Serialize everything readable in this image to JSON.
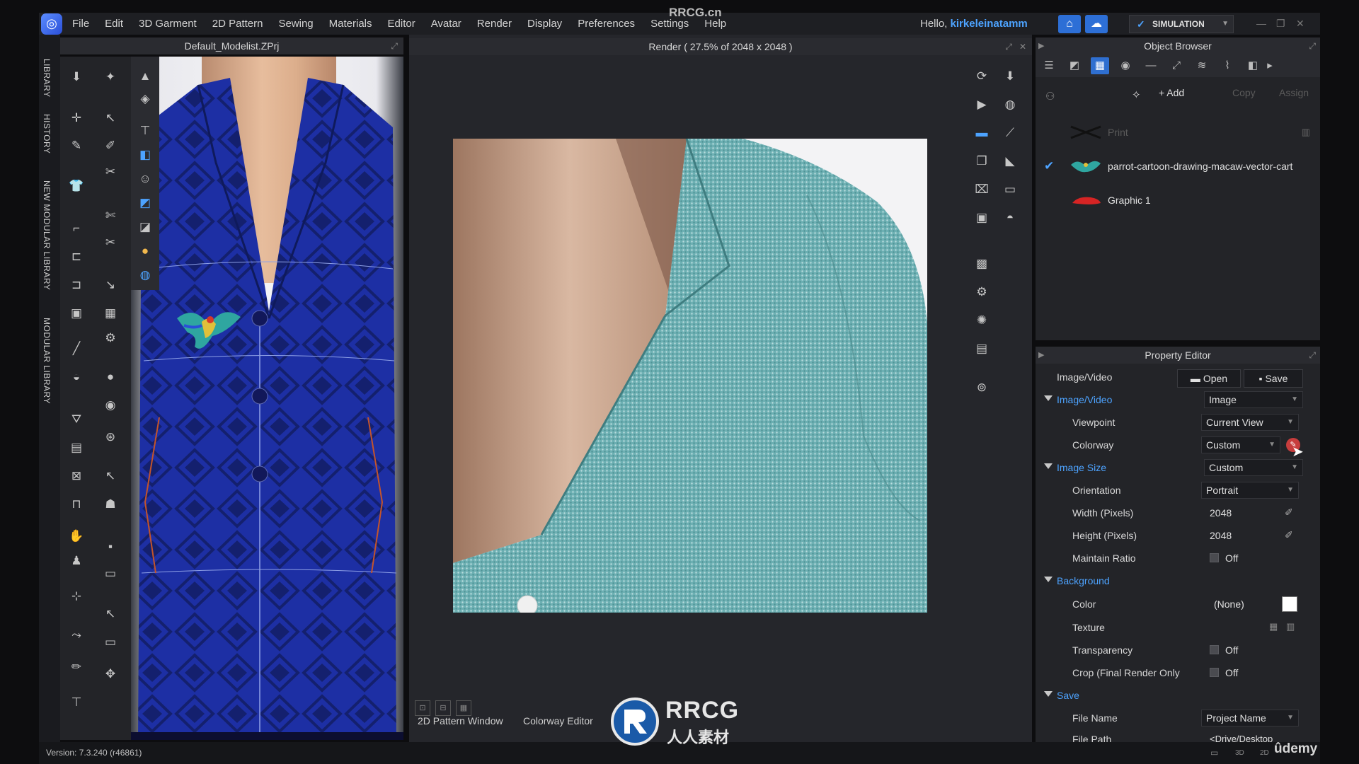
{
  "watermark_top": "RRCG.cn",
  "menubar": {
    "items": [
      "File",
      "Edit",
      "3D Garment",
      "2D Pattern",
      "Sewing",
      "Materials",
      "Editor",
      "Avatar",
      "Render",
      "Display",
      "Preferences",
      "Settings",
      "Help"
    ],
    "greeting": "Hello,",
    "username": "kirkeleinatamm",
    "mode": "SIMULATION"
  },
  "left_tabs": [
    "LIBRARY",
    "HISTORY",
    "NEW MODULAR LIBRARY",
    "MODULAR LIBRARY"
  ],
  "window3d": {
    "title": "Default_Modelist.ZPrj"
  },
  "render": {
    "title": "Render ( 27.5% of 2048 x 2048 )",
    "bottom_tabs": [
      "2D Pattern Window",
      "Colorway Editor"
    ]
  },
  "object_browser": {
    "title": "Object Browser",
    "add_label": "+ Add",
    "copy_label": "Copy",
    "assign_label": "Assign",
    "items": [
      {
        "label": "Print",
        "checked": false,
        "dim": true
      },
      {
        "label": "parrot-cartoon-drawing-macaw-vector-cart",
        "checked": true,
        "dim": false
      },
      {
        "label": "Graphic 1",
        "checked": false,
        "dim": false
      }
    ]
  },
  "property_editor": {
    "title": "Property Editor",
    "header_label": "Image/Video",
    "open_label": "Open",
    "save_label": "Save",
    "image_video": {
      "label": "Image/Video",
      "value": "Image"
    },
    "viewpoint": {
      "label": "Viewpoint",
      "value": "Current View"
    },
    "colorway": {
      "label": "Colorway",
      "value": "Custom"
    },
    "image_size": {
      "label": "Image Size",
      "value": "Custom"
    },
    "orientation": {
      "label": "Orientation",
      "value": "Portrait"
    },
    "width": {
      "label": "Width (Pixels)",
      "value": "2048"
    },
    "height": {
      "label": "Height (Pixels)",
      "value": "2048"
    },
    "maintain_ratio": {
      "label": "Maintain Ratio",
      "value": "Off"
    },
    "background": {
      "label": "Background"
    },
    "color": {
      "label": "Color",
      "value": "(None)"
    },
    "texture": {
      "label": "Texture"
    },
    "transparency": {
      "label": "Transparency",
      "value": "Off"
    },
    "crop": {
      "label": "Crop (Final Render Only",
      "value": "Off"
    },
    "save_section": {
      "label": "Save"
    },
    "file_name": {
      "label": "File Name",
      "value": "Project Name"
    },
    "file_path": {
      "label": "File Path",
      "value": "<Drive/Desktop"
    }
  },
  "status": {
    "version": "Version: 7.3.240 (r46861)"
  },
  "brand": {
    "rrcg": "RRCG",
    "rrcg_cn": "人人素材",
    "udemy": "ûdemy"
  },
  "colors": {
    "accent": "#4da3ff",
    "fabric": "#6fb3b5",
    "garment": "#1c2fa0",
    "panel": "#232428"
  }
}
